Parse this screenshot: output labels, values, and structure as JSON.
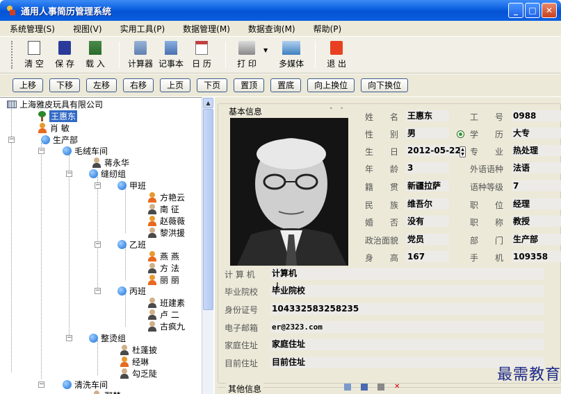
{
  "window": {
    "title": "通用人事简历管理系统"
  },
  "menu": [
    "系统管理(S)",
    "视图(V)",
    "实用工具(P)",
    "数据管理(M)",
    "数据查询(M)",
    "帮助(P)"
  ],
  "toolbar": [
    "清 空",
    "保 存",
    "载 入",
    "计算器",
    "记事本",
    "日 历",
    "打 印",
    "多媒体",
    "退 出"
  ],
  "nav": [
    "上移",
    "下移",
    "左移",
    "右移",
    "上页",
    "下页",
    "置顶",
    "置底",
    "向上换位",
    "向下换位"
  ],
  "tree": {
    "root": "上海雅皮玩具有限公司",
    "nodes": [
      "王惠东",
      "肖 敏",
      "生产部",
      "毛绒车间",
      "蒋永华",
      "缝纫组",
      "甲班",
      "方艳云",
      "南 征",
      "赵薇薇",
      "黎洪援",
      "乙班",
      "燕 燕",
      "方 法",
      "丽 丽",
      "丙班",
      "班建素",
      "卢 二",
      "古疯九",
      "整烫组",
      "杜蓬披",
      "经琳",
      "勾乏陡",
      "清洗车间",
      "鄢楚"
    ]
  },
  "basic": {
    "title": "基本信息",
    "fields": [
      {
        "label": "姓　　名",
        "value": "王惠东"
      },
      {
        "label": "性　　别",
        "value": "男"
      },
      {
        "label": "生　　日",
        "value": "2012-05-22"
      },
      {
        "label": "年　　龄",
        "value": "3"
      },
      {
        "label": "籍　　贯",
        "value": "新疆拉萨"
      },
      {
        "label": "民　　族",
        "value": "维吾尔"
      },
      {
        "label": "婚　　否",
        "value": "没有"
      },
      {
        "label": "政治面貌",
        "value": "党员"
      },
      {
        "label": "身　　高",
        "value": "167"
      }
    ],
    "fields2": [
      {
        "label": "工　　号",
        "value": "0988"
      },
      {
        "label": "学　　历",
        "value": "大专"
      },
      {
        "label": "专　　业",
        "value": "热处理"
      },
      {
        "label": "外语语种",
        "value": "法语"
      },
      {
        "label": "语种等级",
        "value": "7"
      },
      {
        "label": "职　　位",
        "value": "经理"
      },
      {
        "label": "职　　称",
        "value": "教授"
      },
      {
        "label": "部　　门",
        "value": "生产部"
      },
      {
        "label": "手　　机",
        "value": "109358"
      }
    ],
    "wide": [
      {
        "label": "计 算 机",
        "value": "计算机"
      },
      {
        "label": "毕业院校",
        "value": "毕业院校"
      },
      {
        "label": "身份证号",
        "value": "104332583258235"
      },
      {
        "label": "电子邮箱",
        "value": "er@2323.com"
      },
      {
        "label": "家庭住址",
        "value": "家庭住址"
      },
      {
        "label": "目前住址",
        "value": "目前住址"
      }
    ]
  },
  "other": {
    "title": "其他信息"
  },
  "watermark": "最需教育"
}
